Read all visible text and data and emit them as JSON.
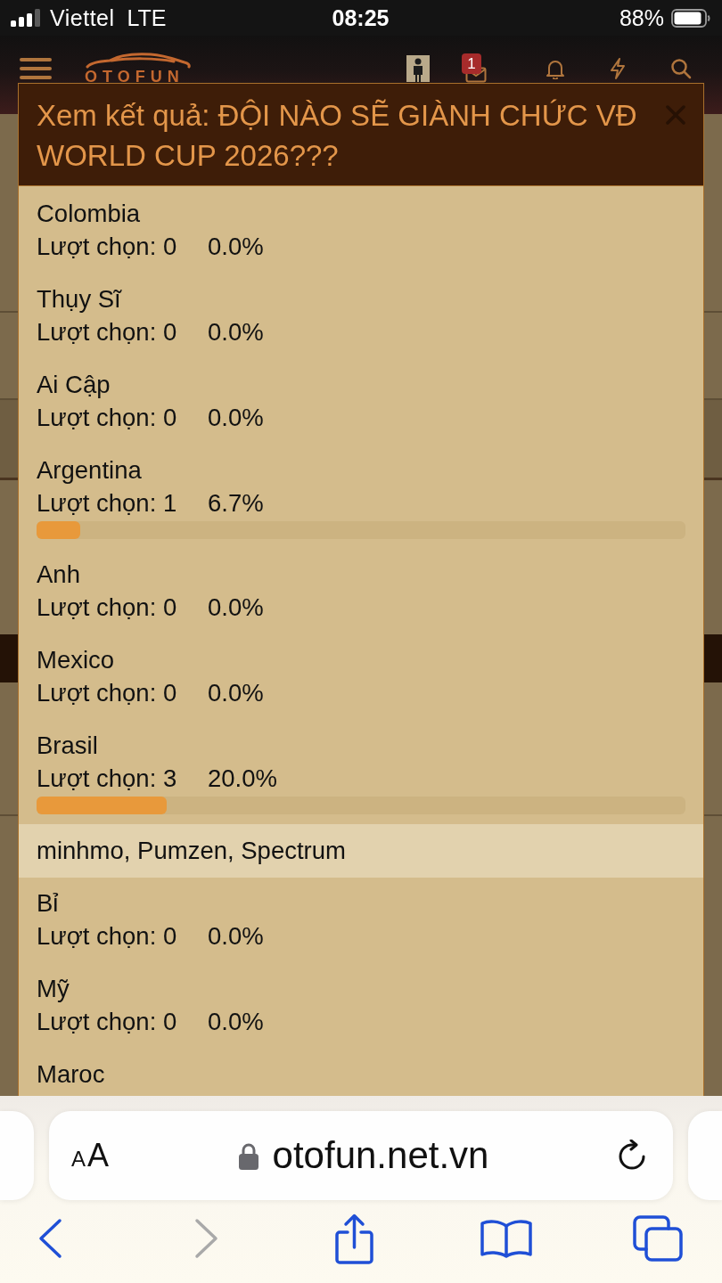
{
  "status_bar": {
    "carrier": "Viettel",
    "network": "LTE",
    "time": "08:25",
    "battery": "88%"
  },
  "site_header": {
    "logo": "OTOFUN",
    "message_badge": "1"
  },
  "poll_results": {
    "title": "Xem kết quả: ĐỘI NÀO SẼ GIÀNH CHỨC VĐ WORLD CUP 2026???",
    "options": [
      {
        "name": "Colombia",
        "votes": "Lượt chọn: 0",
        "percent": "0.0%",
        "level": 0
      },
      {
        "name": "Thụy Sĩ",
        "votes": "Lượt chọn: 0",
        "percent": "0.0%",
        "level": 0
      },
      {
        "name": "Ai Cập",
        "votes": "Lượt chọn: 0",
        "percent": "0.0%",
        "level": 0
      },
      {
        "name": "Argentina",
        "votes": "Lượt chọn: 1",
        "percent": "6.7%",
        "level": 0.067
      },
      {
        "name": "Anh",
        "votes": "Lượt chọn: 0",
        "percent": "0.0%",
        "level": 0
      },
      {
        "name": "Mexico",
        "votes": "Lượt chọn: 0",
        "percent": "0.0%",
        "level": 0
      },
      {
        "name": "Brasil",
        "votes": "Lượt chọn: 3",
        "percent": "20.0%",
        "level": 0.2,
        "voters": "minhmo, Pumzen, Spectrum"
      },
      {
        "name": "Bỉ",
        "votes": "Lượt chọn: 0",
        "percent": "0.0%",
        "level": 0
      },
      {
        "name": "Mỹ",
        "votes": "Lượt chọn: 0",
        "percent": "0.0%",
        "level": 0
      },
      {
        "name": "Maroc"
      }
    ]
  },
  "browser": {
    "text_size": "AA",
    "url": "otofun.net.vn",
    "toolbar": [
      {
        "kind": "back",
        "disabled": false
      },
      {
        "kind": "forward",
        "disabled": true
      },
      {
        "kind": "share",
        "disabled": false
      },
      {
        "kind": "bookmarks",
        "disabled": false
      },
      {
        "kind": "tabs",
        "disabled": false
      }
    ]
  }
}
